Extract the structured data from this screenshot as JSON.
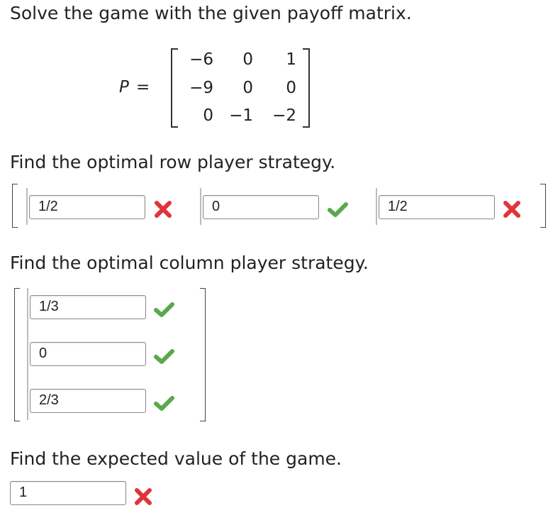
{
  "problem": {
    "prompt": "Solve the game with the given payoff matrix."
  },
  "matrix": {
    "label": "P",
    "equals": "=",
    "rows": [
      [
        "−6",
        "0",
        "1"
      ],
      [
        "−9",
        "0",
        "0"
      ],
      [
        "0",
        "−1",
        "−2"
      ]
    ]
  },
  "row_strategy": {
    "prompt": "Find the optimal row player strategy.",
    "entries": [
      {
        "value": "1/2",
        "status": "incorrect"
      },
      {
        "value": "0",
        "status": "correct"
      },
      {
        "value": "1/2",
        "status": "incorrect"
      }
    ]
  },
  "column_strategy": {
    "prompt": "Find the optimal column player strategy.",
    "entries": [
      {
        "value": "1/3",
        "status": "correct"
      },
      {
        "value": "0",
        "status": "correct"
      },
      {
        "value": "2/3",
        "status": "correct"
      }
    ]
  },
  "expected_value": {
    "prompt": "Find the expected value of the game.",
    "value": "1",
    "status": "incorrect"
  },
  "colors": {
    "correct": "#5aa84a",
    "incorrect": "#e0343a"
  },
  "icons": {
    "correct": "check-icon",
    "incorrect": "cross-icon"
  }
}
